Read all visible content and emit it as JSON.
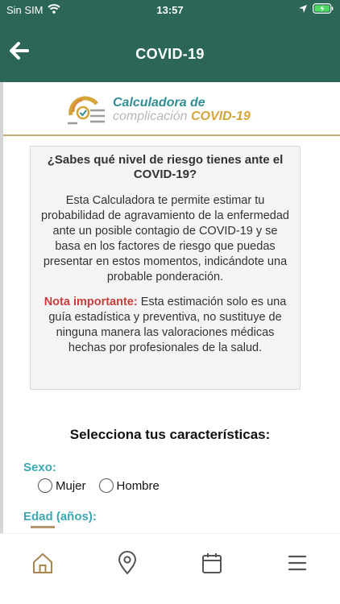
{
  "status_bar": {
    "carrier": "Sin SIM",
    "time": "13:57"
  },
  "nav": {
    "title": "COVID-19"
  },
  "logo": {
    "line1": "Calculadora de",
    "line2_prefix": "complicación",
    "line2_highlight": "COVID-19"
  },
  "card": {
    "question": "¿Sabes qué nivel de riesgo tienes ante el COVID-19?",
    "description": "Esta Calculadora te permite estimar tu probabilidad de agravamiento de la enfermedad ante un posible contagio de COVID-19 y se basa en los factores de riesgo que puedas presentar en estos momentos, indicándote una probable ponderación.",
    "note_label": "Nota importante:",
    "note_text": "Esta estimación solo es una guía estadística y preventiva, no sustituye de ninguna manera las valoraciones médicas hechas por profesionales de la salud."
  },
  "form": {
    "section_title": "Selecciona tus características:",
    "sex_label": "Sexo:",
    "sex_options": [
      "Mujer",
      "Hombre"
    ],
    "age_label": "Edad (años):"
  },
  "tabs": [
    "home-icon",
    "location-pin-icon",
    "calendar-icon",
    "menu-icon"
  ],
  "colors": {
    "header": "#2b6656",
    "accent_teal": "#3fa7b0",
    "accent_gold": "#d4a63a",
    "note_red": "#c93d3d"
  }
}
